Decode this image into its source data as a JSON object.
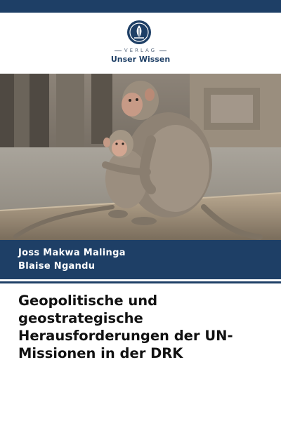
{
  "publisher": {
    "label": "VERLAG",
    "name": "Unser Wissen"
  },
  "cover_image": {
    "icon": "monkeys-photo"
  },
  "authors": [
    "Joss Makwa Malinga",
    "Blaise Ngandu"
  ],
  "book_title": "Geopolitische und geostrategische Herausforderungen der UN-Missionen in der DRK",
  "colors": {
    "band": "#1e3f66",
    "text": "#111111",
    "background": "#ffffff"
  }
}
